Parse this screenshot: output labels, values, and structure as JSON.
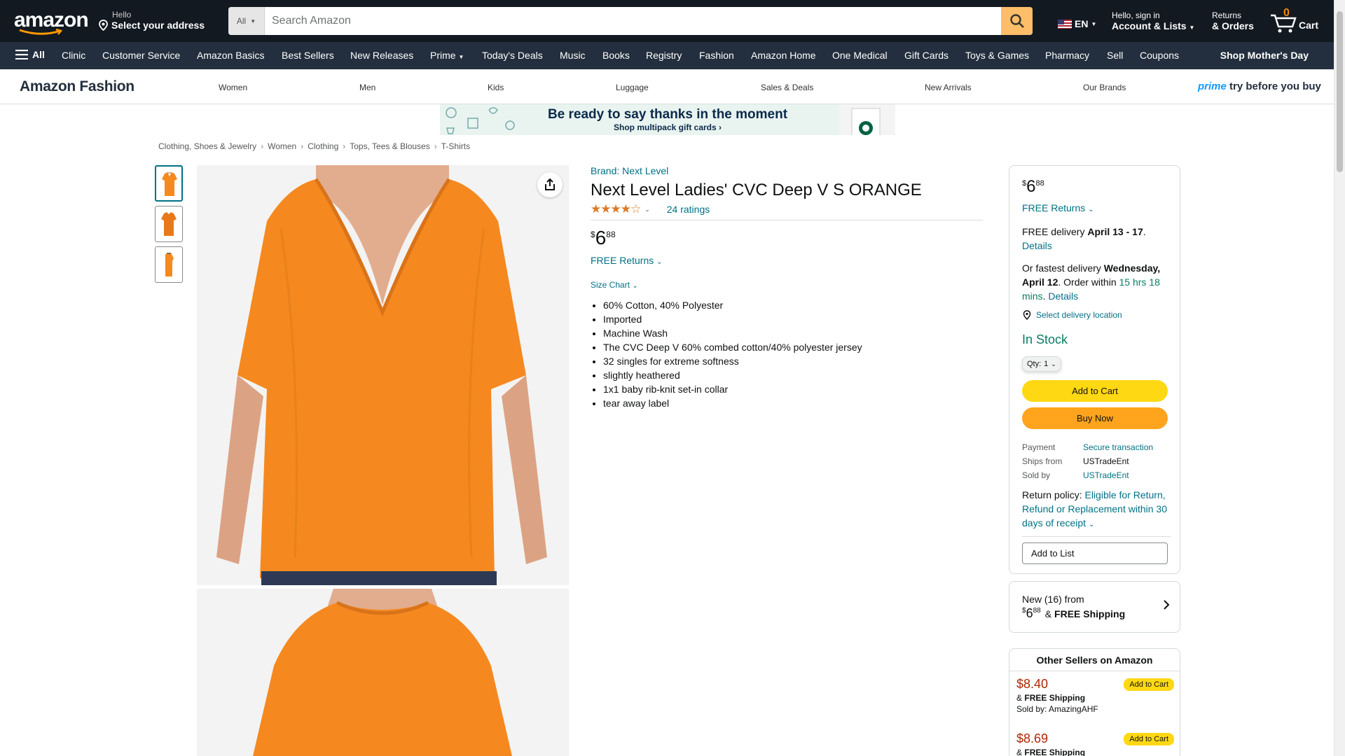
{
  "nav": {
    "logo": "amazon",
    "address_hello": "Hello",
    "address_select": "Select your address",
    "search_category": "All",
    "search_placeholder": "Search Amazon",
    "lang": "EN",
    "account_hello": "Hello, sign in",
    "account_lists": "Account & Lists",
    "returns": "Returns",
    "orders": "& Orders",
    "cart_count": "0",
    "cart_label": "Cart"
  },
  "main_nav": {
    "all": "All",
    "items": [
      "Clinic",
      "Customer Service",
      "Amazon Basics",
      "Best Sellers",
      "New Releases",
      "Prime",
      "Today's Deals",
      "Music",
      "Books",
      "Registry",
      "Fashion",
      "Amazon Home",
      "One Medical",
      "Gift Cards",
      "Toys & Games",
      "Pharmacy",
      "Sell",
      "Coupons"
    ],
    "promo": "Shop Mother's Day"
  },
  "fashion": {
    "logo": "Amazon Fashion",
    "items": [
      "Women",
      "Men",
      "Kids",
      "Luggage",
      "Sales & Deals",
      "New Arrivals",
      "Our Brands"
    ],
    "prime": "prime",
    "try": "try before you buy"
  },
  "banner": {
    "line1": "Be ready to say thanks in the moment",
    "line2": "Shop multipack gift cards ›"
  },
  "breadcrumb": [
    "Clothing, Shoes & Jewelry",
    "Women",
    "Clothing",
    "Tops, Tees & Blouses",
    "T-Shirts"
  ],
  "product": {
    "brand": "Brand: Next Level",
    "title": "Next Level Ladies' CVC Deep V S ORANGE",
    "stars": "★★★★☆",
    "star_value": 4.5,
    "ratings": "24 ratings",
    "price_symbol": "$",
    "price_whole": "6",
    "price_fraction": "88",
    "free_returns": "FREE Returns",
    "size_chart": "Size Chart",
    "bullets": [
      "60% Cotton, 40% Polyester",
      "Imported",
      "Machine Wash",
      "The CVC Deep V 60% combed cotton/40% polyester jersey",
      "32 singles for extreme softness",
      "slightly heathered",
      "1x1 baby rib-knit set-in collar",
      "tear away label"
    ],
    "shirt_color": "#f5891f"
  },
  "buybox": {
    "free_returns": "FREE Returns",
    "delivery_prefix": "FREE delivery",
    "delivery_dates": "April 13 - 17",
    "details": "Details",
    "fastest_prefix": "Or fastest delivery",
    "fastest_date": "Wednesday, April 12",
    "order_within": "Order within",
    "countdown": "15 hrs 18 mins",
    "select_location": "Select delivery location",
    "stock": "In Stock",
    "qty_label": "Qty:",
    "qty_value": "1",
    "add_to_cart": "Add to Cart",
    "buy_now": "Buy Now",
    "payment_k": "Payment",
    "payment_v": "Secure transaction",
    "ships_k": "Ships from",
    "ships_v": "USTradeEnt",
    "sold_k": "Sold by",
    "sold_v": "USTradeEnt",
    "return_policy": "Return policy:",
    "return_link": "Eligible for Return, Refund or Replacement within 30 days of receipt",
    "add_to_list": "Add to List"
  },
  "new_from": {
    "line1": "New (16) from",
    "symbol": "$",
    "whole": "6",
    "fraction": "88",
    "shipping_prefix": "&",
    "shipping": "FREE Shipping"
  },
  "other_sellers": {
    "title": "Other Sellers on Amazon",
    "offers": [
      {
        "price": "$8.40",
        "ship_prefix": "&",
        "ship": "FREE Shipping",
        "sold_label": "Sold by:",
        "seller": "AmazingAHF",
        "button": "Add to Cart"
      },
      {
        "price": "$8.69",
        "ship_prefix": "&",
        "ship": "FREE Shipping",
        "button": "Add to Cart"
      }
    ]
  }
}
